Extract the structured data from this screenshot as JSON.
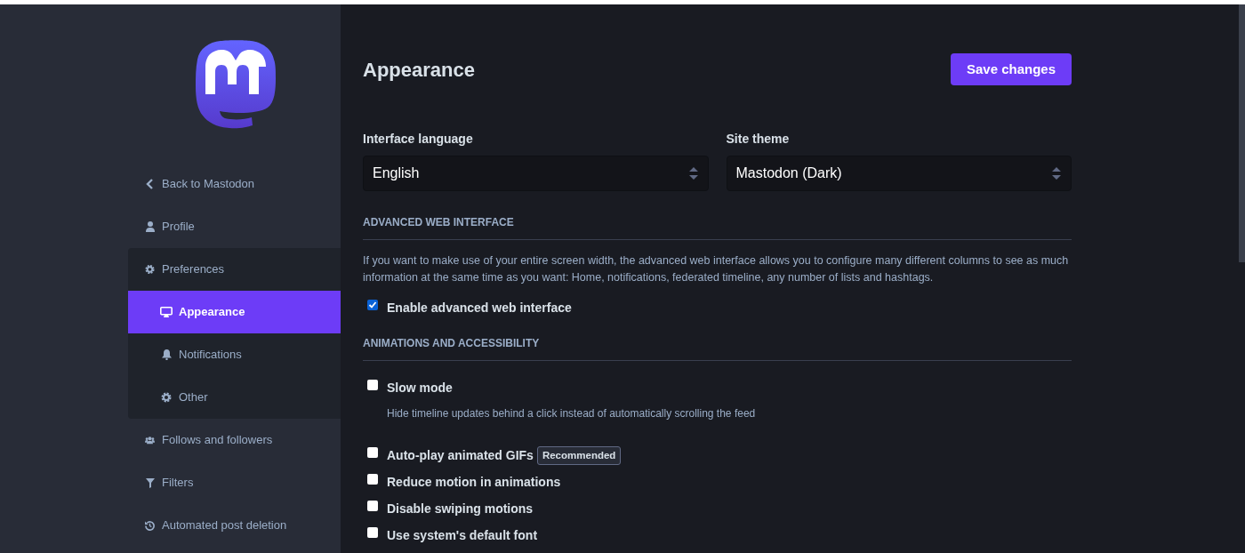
{
  "sidebar": {
    "items": [
      {
        "label": "Back to Mastodon",
        "selected": false
      },
      {
        "label": "Profile",
        "selected": false
      },
      {
        "label": "Preferences",
        "selected": false,
        "expanded": true,
        "children": [
          {
            "label": "Appearance",
            "selected": true
          },
          {
            "label": "Notifications",
            "selected": false
          },
          {
            "label": "Other",
            "selected": false
          }
        ]
      },
      {
        "label": "Follows and followers",
        "selected": false
      },
      {
        "label": "Filters",
        "selected": false
      },
      {
        "label": "Automated post deletion",
        "selected": false
      }
    ]
  },
  "page": {
    "title": "Appearance",
    "save_button": "Save changes"
  },
  "fields": [
    {
      "label": "Interface language",
      "value": "English"
    },
    {
      "label": "Site theme",
      "value": "Mastodon (Dark)"
    }
  ],
  "sections": [
    {
      "heading": "ADVANCED WEB INTERFACE",
      "description": "If you want to make use of your entire screen width, the advanced web interface allows you to configure many different columns to see as much information at the same time as you want: Home, notifications, federated timeline, any number of lists and hashtags.",
      "options": [
        {
          "label": "Enable advanced web interface",
          "checked": true
        }
      ]
    },
    {
      "heading": "ANIMATIONS AND ACCESSIBILITY",
      "options": [
        {
          "label": "Slow mode",
          "checked": false,
          "hint": "Hide timeline updates behind a click instead of automatically scrolling the feed"
        },
        {
          "label": "Auto-play animated GIFs",
          "checked": false,
          "badge": "Recommended"
        },
        {
          "label": "Reduce motion in animations",
          "checked": false
        },
        {
          "label": "Disable swiping motions",
          "checked": false
        },
        {
          "label": "Use system's default font",
          "checked": false
        }
      ]
    }
  ]
}
